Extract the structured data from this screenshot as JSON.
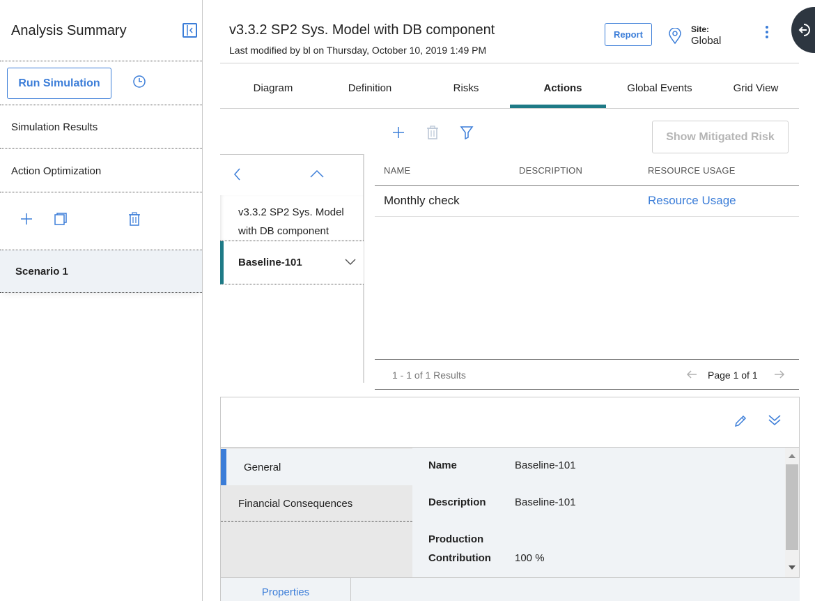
{
  "left_panel": {
    "title": "Analysis Summary",
    "run_simulation_label": "Run Simulation",
    "nav_items": [
      "Simulation Results",
      "Action Optimization"
    ],
    "scenario_label": "Scenario 1"
  },
  "header": {
    "title": "v3.3.2 SP2 Sys. Model with DB component",
    "subtitle": "Last modified by bl on Thursday, October 10, 2019 1:49 PM",
    "report_label": "Report",
    "site_label": "Site:",
    "site_value": "Global"
  },
  "tabs": [
    {
      "label": "Diagram",
      "active": false
    },
    {
      "label": "Definition",
      "active": false
    },
    {
      "label": "Risks",
      "active": false
    },
    {
      "label": "Actions",
      "active": true
    },
    {
      "label": "Global Events",
      "active": false
    },
    {
      "label": "Grid View",
      "active": false
    }
  ],
  "toolbar": {
    "show_mitigated_label": "Show Mitigated Risk"
  },
  "tree": {
    "items": [
      "v3.3.2 SP2 Sys. Model with DB component",
      "Baseline-101"
    ]
  },
  "table": {
    "headers": [
      "NAME",
      "DESCRIPTION",
      "RESOURCE USAGE"
    ],
    "rows": [
      {
        "name": "Monthly check",
        "description": "",
        "resource_usage": "Resource Usage"
      }
    ],
    "results_text": "1 - 1 of 1 Results",
    "page_text": "Page 1 of 1"
  },
  "detail": {
    "sections": [
      "General",
      "Financial Consequences"
    ],
    "fields": [
      {
        "label": "Name",
        "value": "Baseline-101"
      },
      {
        "label": "Description",
        "value": "Baseline-101"
      },
      {
        "label_line1": "Production",
        "label_line2": "Contribution",
        "value": "100 %"
      }
    ],
    "bottom_tab": "Properties"
  },
  "colors": {
    "accent": "#3b7dd8",
    "teal": "#1e7a86",
    "dark": "#2d3640"
  }
}
